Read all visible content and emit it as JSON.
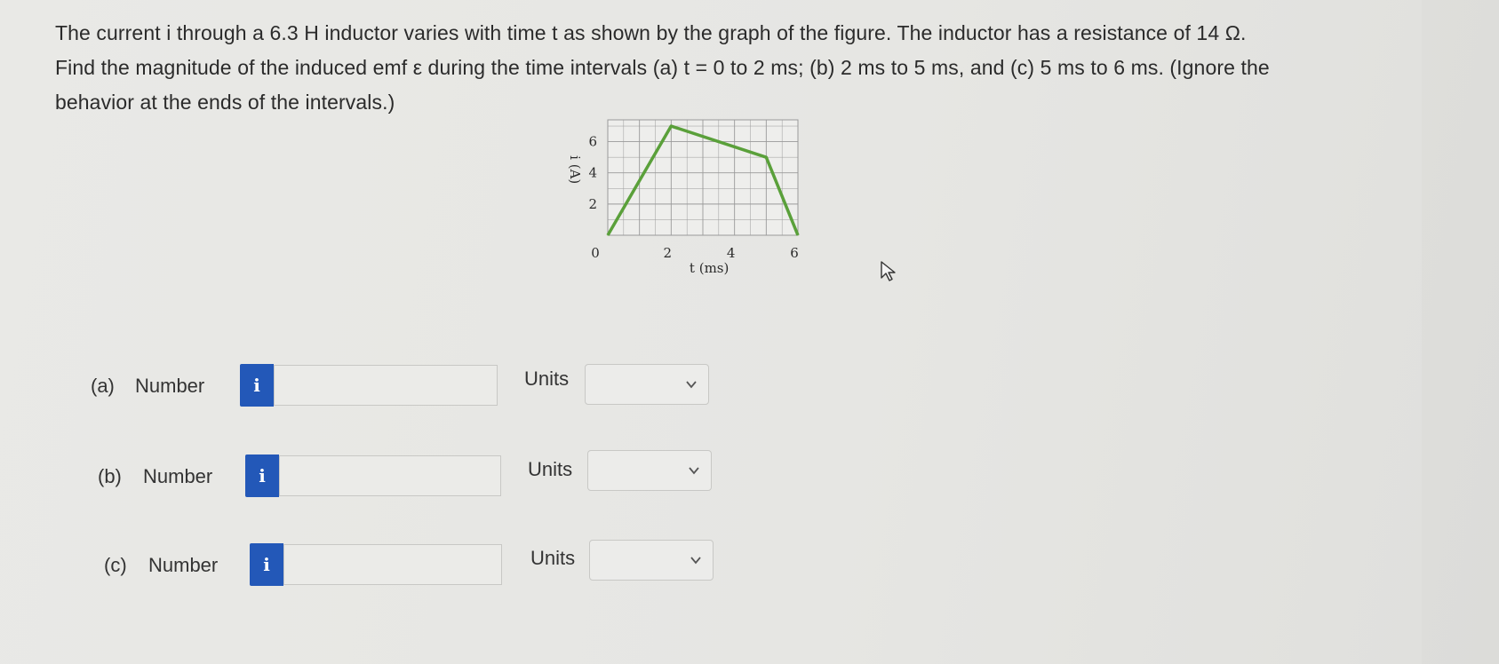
{
  "question": {
    "line1": "The current i through a 6.3 H inductor varies with time t as shown by the graph of the figure. The inductor has a resistance of 14 Ω.",
    "line2": "Find the magnitude of the induced emf ε during the time intervals (a) t = 0 to 2 ms; (b) 2 ms to 5 ms, and (c) 5 ms to 6 ms. (Ignore the",
    "line3": "behavior at the ends of the intervals.)"
  },
  "chart_data": {
    "type": "line",
    "xlabel": "t (ms)",
    "ylabel": "i (A)",
    "xlim": [
      0,
      6
    ],
    "ylim": [
      0,
      7.4
    ],
    "x_ticks": [
      "0",
      "2",
      "4",
      "6"
    ],
    "y_ticks": [
      "2",
      "4",
      "6"
    ],
    "grid": true,
    "color": "#5aa03a",
    "series": [
      {
        "x": [
          0,
          2,
          5,
          6
        ],
        "y": [
          0,
          7,
          5,
          0
        ]
      }
    ]
  },
  "parts": [
    {
      "label": "(a)",
      "number_label": "Number",
      "value": "",
      "units_label": "Units",
      "units_value": ""
    },
    {
      "label": "(b)",
      "number_label": "Number",
      "value": "",
      "units_label": "Units",
      "units_value": ""
    },
    {
      "label": "(c)",
      "number_label": "Number",
      "value": "",
      "units_label": "Units",
      "units_value": ""
    }
  ],
  "colors": {
    "info_button": "#2358b8",
    "curve": "#5aa03a",
    "grid": "#9a9a9a"
  },
  "icons": {
    "info": "i",
    "dropdown": "chevron-down-icon",
    "cursor": "mouse-pointer-icon"
  }
}
